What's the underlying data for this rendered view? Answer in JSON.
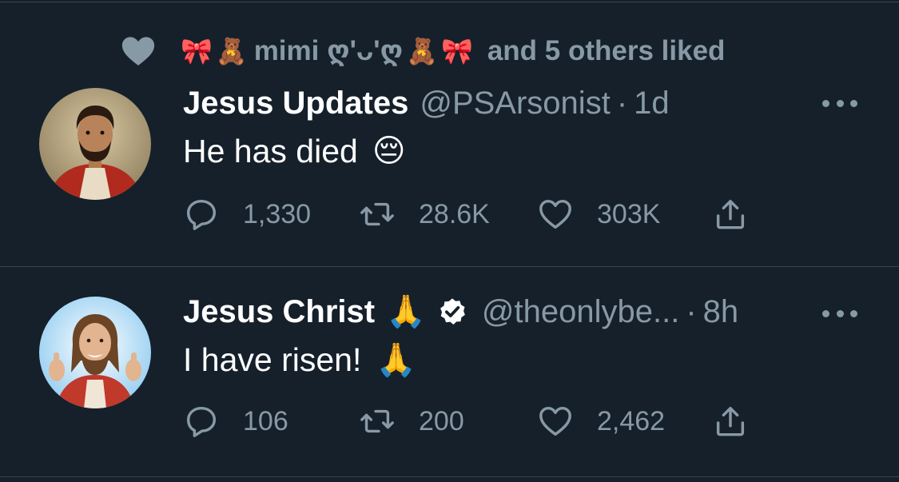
{
  "social_context": {
    "liked_by": "mimi ღ'ᴗ'ღ",
    "suffix": "and 5 others liked",
    "decor_emojis": [
      "🎀",
      "🧸"
    ]
  },
  "tweets": [
    {
      "display_name": "Jesus Updates",
      "handle": "@PSArsonist",
      "time": "1d",
      "verified": false,
      "text": "He has died",
      "text_emoji": "😔",
      "counts": {
        "reply": "1,330",
        "retweet": "28.6K",
        "like": "303K"
      }
    },
    {
      "display_name": "Jesus Christ",
      "name_emoji": "🙏",
      "handle": "@theonlybe...",
      "time": "8h",
      "verified": true,
      "text": "I have risen!",
      "text_emoji": "🙏",
      "counts": {
        "reply": "106",
        "retweet": "200",
        "like": "2,462"
      }
    }
  ],
  "colors": {
    "background": "#15202b",
    "divider": "#38444d",
    "secondary_text": "#8899a6",
    "primary_text": "#ffffff"
  },
  "icons": {
    "reply": "reply-icon",
    "retweet": "retweet-icon",
    "like": "heart-icon",
    "share": "share-icon",
    "more": "more-icon",
    "verified": "verified-badge-icon"
  }
}
